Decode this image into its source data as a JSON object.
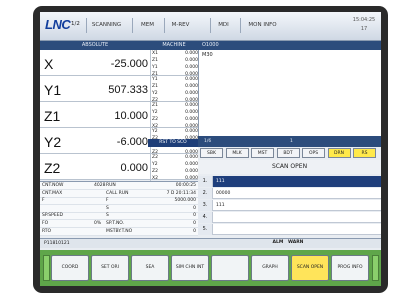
{
  "app": {
    "logo": "LNC",
    "page": "1/2"
  },
  "tabs": [
    "SCANNING",
    "MEM",
    "M-REV",
    "MDI",
    "MON INFO"
  ],
  "clock": {
    "time": "15:04:25",
    "day": "17"
  },
  "headers": {
    "absolute": "ABSOLUTE",
    "machine": "MACHINE",
    "program": "O1000"
  },
  "axes": [
    {
      "name": "X",
      "value": "-25.000",
      "machine": [
        [
          "X1",
          "0.000"
        ],
        [
          "Z1",
          "0.000"
        ],
        [
          "Y1",
          "0.000"
        ],
        [
          "Z1",
          "0.000"
        ]
      ]
    },
    {
      "name": "Y1",
      "value": "507.333",
      "machine": [
        [
          "Y1",
          "0.000"
        ],
        [
          "Z1",
          "0.000"
        ],
        [
          "Y2",
          "0.000"
        ],
        [
          "Z2",
          "0.000"
        ]
      ]
    },
    {
      "name": "Z1",
      "value": "10.000",
      "machine": [
        [
          "Z1",
          "0.000"
        ],
        [
          "Y2",
          "0.000"
        ],
        [
          "Z2",
          "0.000"
        ],
        [
          "X2",
          "0.000"
        ]
      ]
    },
    {
      "name": "Y2",
      "value": "-6.000",
      "machine": [
        [
          "Y2",
          "0.000"
        ],
        [
          "Z2",
          "0.000"
        ],
        [
          "Y2",
          "0.000"
        ],
        [
          "Z2",
          "0.000"
        ]
      ]
    },
    {
      "name": "Z2",
      "value": "0.000",
      "machine": [
        [
          "Z2",
          "0.000"
        ],
        [
          "Y2",
          "0.000"
        ],
        [
          "Z2",
          "0.000"
        ],
        [
          "X2",
          "0.000"
        ]
      ]
    }
  ],
  "program_text": "M30",
  "message": "RST TO SCO",
  "status_line": {
    "left": "1/6",
    "right": "1"
  },
  "status_buttons": [
    "SBK",
    "MLK",
    "MST",
    "BDT",
    "OPS",
    "DRN",
    "RS"
  ],
  "status_highlight": [
    false,
    false,
    false,
    false,
    false,
    true,
    true
  ],
  "scan": {
    "title": "SCAN OPEN",
    "rows": [
      {
        "n": "1.",
        "v": "111",
        "sel": true
      },
      {
        "n": "2.",
        "v": "00000",
        "sel": false
      },
      {
        "n": "3.",
        "v": "111",
        "sel": false
      },
      {
        "n": "4.",
        "v": "",
        "sel": false
      },
      {
        "n": "5.",
        "v": "",
        "sel": false
      }
    ]
  },
  "info": [
    [
      "CNT.NOW",
      "4028",
      "RUN",
      "00:00:25"
    ],
    [
      "CNT.MAX",
      "",
      "CALL RUN",
      "7 D 20:11:34"
    ],
    [
      "F",
      "",
      "F",
      "5000.000"
    ],
    [
      "",
      "",
      "S",
      "0"
    ],
    [
      "SP.SPEED",
      "",
      "S",
      "0"
    ],
    [
      "FO",
      "0%",
      "SP.T.NO.",
      "0"
    ],
    [
      "RTO",
      "",
      "MSTBY.T.NO",
      "0"
    ]
  ],
  "bottom": {
    "program": "P11810121",
    "alarm": "ALM",
    "warn": "WARN"
  },
  "softkeys": [
    {
      "label": "COORD",
      "hi": false
    },
    {
      "label": "SET ORI",
      "hi": false
    },
    {
      "label": "SEA",
      "hi": false
    },
    {
      "label": "SIM CHN INT",
      "hi": false
    },
    {
      "label": "",
      "hi": false
    },
    {
      "label": "GRAPH",
      "hi": false
    },
    {
      "label": "SCAN OPEN",
      "hi": true
    },
    {
      "label": "PROG INFO",
      "hi": false
    }
  ]
}
